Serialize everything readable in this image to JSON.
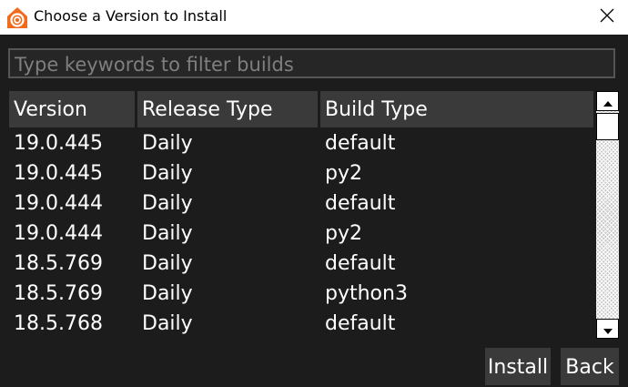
{
  "window": {
    "title": "Choose a Version to Install",
    "app_icon": "houdini-icon",
    "close_icon": "close-icon"
  },
  "filter": {
    "placeholder": "Type keywords to filter builds",
    "value": ""
  },
  "table": {
    "columns": [
      "Version",
      "Release Type",
      "Build Type"
    ],
    "rows": [
      [
        "19.0.445",
        "Daily",
        "default"
      ],
      [
        "19.0.445",
        "Daily",
        "py2"
      ],
      [
        "19.0.444",
        "Daily",
        "default"
      ],
      [
        "19.0.444",
        "Daily",
        "py2"
      ],
      [
        "18.5.769",
        "Daily",
        "default"
      ],
      [
        "18.5.769",
        "Daily",
        "python3"
      ],
      [
        "18.5.768",
        "Daily",
        "default"
      ]
    ]
  },
  "scrollbar": {
    "up_icon": "arrow-up-icon",
    "down_icon": "arrow-down-icon"
  },
  "buttons": {
    "install": "Install",
    "back": "Back"
  },
  "colors": {
    "background": "#1c1c1c",
    "header": "#3a3a3a",
    "accent": "#f26b1d"
  }
}
